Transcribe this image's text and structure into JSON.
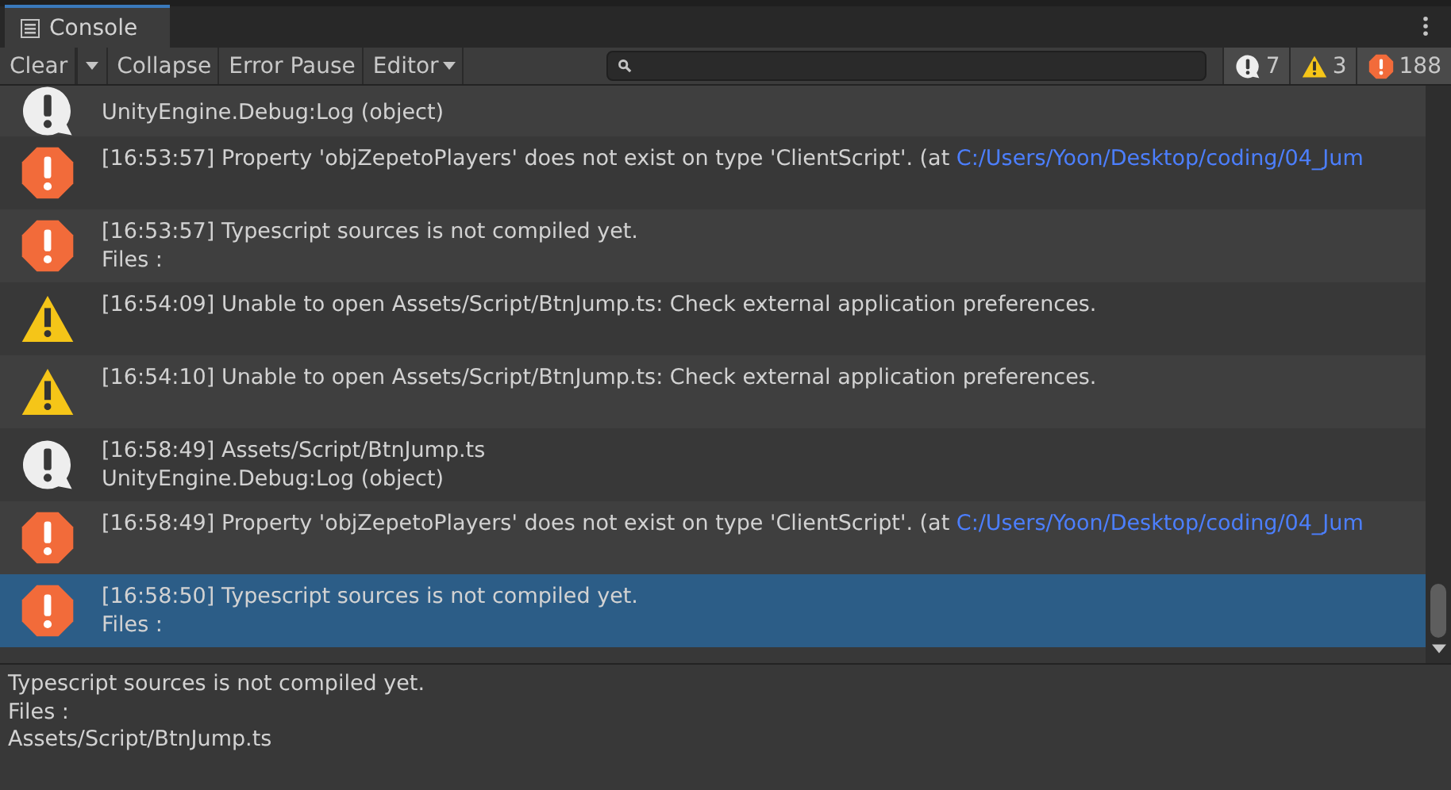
{
  "tab": {
    "title": "Console",
    "selected": true
  },
  "toolbar": {
    "buttons": [
      {
        "label": "Clear",
        "kind": "split"
      },
      {
        "label": "Collapse",
        "kind": "plain"
      },
      {
        "label": "Error Pause",
        "kind": "plain"
      },
      {
        "label": "Editor",
        "kind": "dropdown"
      }
    ],
    "counters": [
      {
        "kind": "log",
        "count": "7"
      },
      {
        "kind": "warning",
        "count": "3"
      },
      {
        "kind": "error",
        "count": "188"
      }
    ]
  },
  "entries": [
    {
      "kind": "log",
      "selected": false,
      "lines": [
        "UnityEngine.Debug:Log (object)"
      ]
    },
    {
      "kind": "error",
      "selected": false,
      "lines": [
        "[16:53:57] Property 'objZepetoPlayers' does not exist on type 'ClientScript'. (at "
      ],
      "link": "C:/Users/Yoon/Desktop/coding/04_Jum"
    },
    {
      "kind": "error",
      "selected": false,
      "lines": [
        "[16:53:57] Typescript sources is not compiled yet.",
        "Files :"
      ]
    },
    {
      "kind": "warning",
      "selected": false,
      "lines": [
        "[16:54:09] Unable to open Assets/Script/BtnJump.ts: Check external application preferences."
      ]
    },
    {
      "kind": "warning",
      "selected": false,
      "lines": [
        "[16:54:10] Unable to open Assets/Script/BtnJump.ts: Check external application preferences."
      ]
    },
    {
      "kind": "log",
      "selected": false,
      "lines": [
        "[16:58:49] Assets/Script/BtnJump.ts",
        "UnityEngine.Debug:Log (object)"
      ]
    },
    {
      "kind": "error",
      "selected": false,
      "lines": [
        "[16:58:49] Property 'objZepetoPlayers' does not exist on type 'ClientScript'. (at "
      ],
      "link": "C:/Users/Yoon/Desktop/coding/04_Jum"
    },
    {
      "kind": "error",
      "selected": true,
      "lines": [
        "[16:58:50] Typescript sources is not compiled yet.",
        "Files :"
      ]
    }
  ],
  "details": [
    "Typescript sources is not compiled yet.",
    "Files :",
    "Assets/Script/BtnJump.ts"
  ]
}
